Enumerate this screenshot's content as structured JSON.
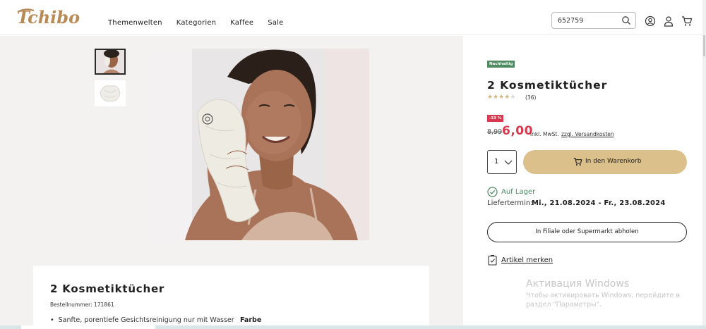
{
  "header": {
    "logo_text": "Tchibo",
    "nav": [
      "Themenwelten",
      "Kategorien",
      "Kaffee",
      "Sale"
    ],
    "search_value": "652759",
    "icons": [
      "search-icon",
      "account-icon",
      "user-icon",
      "cart-icon"
    ]
  },
  "gallery": {
    "thumbnails": [
      "woman-towel-thumbnail",
      "cloth-thumbnail"
    ],
    "main_image": "woman-with-cosmetic-cloth"
  },
  "product": {
    "badge_sustainable": "Nachhaltig",
    "title": "2 Kosmetiktücher",
    "rating": 4,
    "rating_max": 5,
    "review_count": "(36)",
    "discount_badge": "-33 %",
    "old_price": "8,99",
    "new_price": "6,00",
    "tax_note": "inkl. MwSt.",
    "shipping_link": "zzgl. Versandkosten",
    "quantity": "1",
    "add_to_cart": "In den Warenkorb",
    "stock_status": "Auf Lager",
    "delivery_label": "Liefertermin:",
    "delivery_value": "Mi., 21.08.2024 - Fr., 23.08.2024",
    "pickup_button": "In Filiale oder Supermarkt abholen",
    "wishlist_link": "Artikel merken"
  },
  "details": {
    "title": "2 Kosmetiktücher",
    "order_number": "Bestellnummer: 171861",
    "bullet_1": "Sanfte, porentiefe Gesichtsreinigung nur mit Wasser",
    "farbe_label": "Farbe"
  },
  "watermark": {
    "title": "Активация Windows",
    "text": "Чтобы активировать Windows, перейдите в раздел \"Параметры\"."
  },
  "colors": {
    "accent_gold": "#dcc08c",
    "sale_red": "#d9394e",
    "stock_green": "#4f8a63"
  }
}
